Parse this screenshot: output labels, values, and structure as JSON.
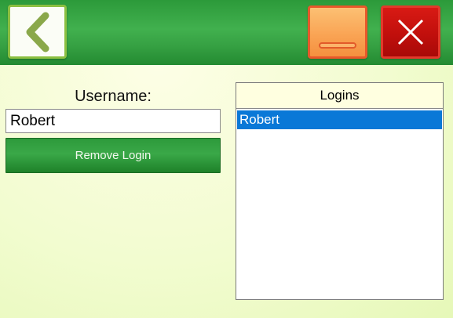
{
  "header": {
    "back_icon": "chevron-left-icon",
    "minimize_icon": "minimize-icon",
    "close_icon": "close-icon",
    "colors": {
      "bar": "#36a143",
      "minimize": "#f9a252",
      "close": "#c10f0c"
    }
  },
  "form": {
    "username_label": "Username:",
    "username_value": "Robert",
    "remove_button_label": "Remove Login"
  },
  "logins": {
    "header": "Logins",
    "items": [
      {
        "label": "Robert",
        "selected": true
      }
    ],
    "selected_color": "#0a78d7"
  }
}
